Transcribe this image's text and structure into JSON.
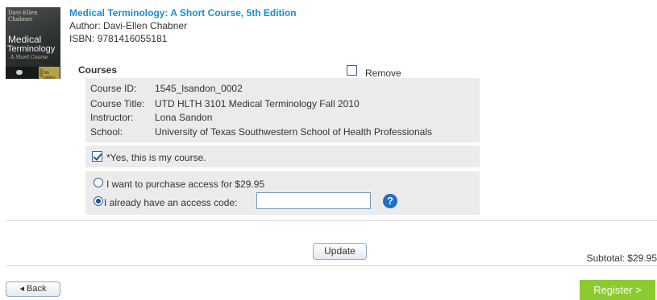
{
  "book": {
    "cover_text_top": "Davi-Ellen Chabner",
    "cover_title_line1": "Medical",
    "cover_title_line2": "Terminology",
    "cover_subtitle": "A Short Course",
    "cover_edition": "5th edition",
    "title": "Medical Terminology: A Short Course, 5th Edition",
    "author": "Author: Davi-Ellen Chabner",
    "isbn": "ISBN: 9781416055181"
  },
  "courses": {
    "heading": "Courses",
    "remove_label": "Remove",
    "remove_checked": false,
    "details": [
      {
        "label": "Course ID:",
        "value": "1545_lsandon_0002"
      },
      {
        "label": "Course Title:",
        "value": "UTD HLTH 3101 Medical Terminology Fall 2010"
      },
      {
        "label": "Instructor:",
        "value": "Lona Sandon"
      },
      {
        "label": "School:",
        "value": "University of Texas Southwestern School of Health Professionals"
      }
    ],
    "confirm_label": "*Yes, this is my course.",
    "confirm_checked": true
  },
  "access": {
    "purchase_label": "I want to purchase access for $29.95",
    "code_label": "I already have an access code:",
    "selected": "code",
    "code_value": "",
    "help_glyph": "?",
    "help_icon": "help-icon"
  },
  "cart": {
    "update_label": "Update",
    "subtotal": "Subtotal: $29.95"
  },
  "nav": {
    "back_label": "◂ Back",
    "register_label": "Register  >"
  },
  "colors": {
    "link": "#1a8cd6",
    "panel": "#ebebeb",
    "register": "#8ccb2f",
    "help": "#1f6fc4"
  }
}
